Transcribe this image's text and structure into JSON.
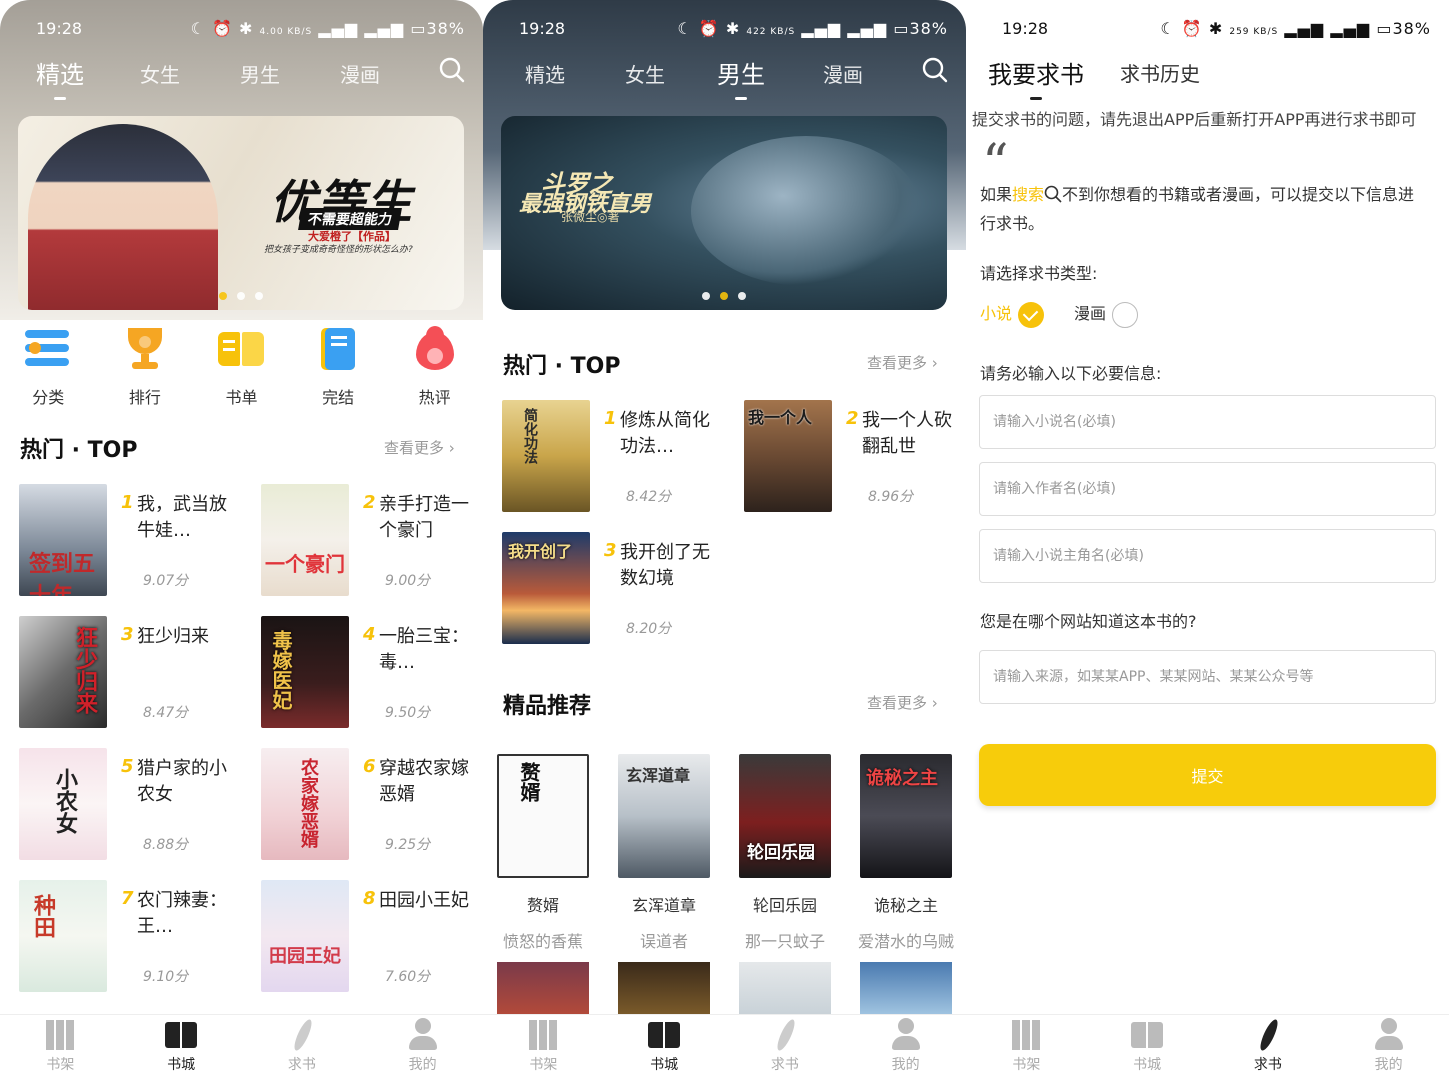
{
  "status": {
    "time": "19:28",
    "p1_speed": "4.00 KB/S",
    "p2_speed": "422 KB/S",
    "p3_speed": "259 KB/S",
    "battery": "38%"
  },
  "top_tabs": [
    "精选",
    "女生",
    "男生",
    "漫画"
  ],
  "panel1": {
    "active_tab": "精选",
    "banner": {
      "title": "优等生",
      "subtitle": "不需要超能力",
      "author": "大爱橙了【作品】",
      "desc": "把女孩子变成奇奇怪怪的形状怎么办?"
    },
    "categories": [
      {
        "label": "分类",
        "icon": "category-icon",
        "color": "#3aa0f2"
      },
      {
        "label": "排行",
        "icon": "trophy-icon",
        "color": "#f5a623"
      },
      {
        "label": "书单",
        "icon": "booklist-icon",
        "color": "#f7c20a"
      },
      {
        "label": "完结",
        "icon": "finished-icon",
        "color": "#3aa0f2"
      },
      {
        "label": "热评",
        "icon": "flame-icon",
        "color": "#f44f56"
      }
    ],
    "section_title": "热门 · TOP",
    "more": "查看更多 ›",
    "books": [
      {
        "rank": "1",
        "title": "我，武当放牛娃…",
        "score": "9.07分"
      },
      {
        "rank": "2",
        "title": "亲手打造一个豪门",
        "score": "9.00分"
      },
      {
        "rank": "3",
        "title": "狂少归来",
        "score": "8.47分"
      },
      {
        "rank": "4",
        "title": "一胎三宝：毒…",
        "score": "9.50分"
      },
      {
        "rank": "5",
        "title": "猎户家的小农女",
        "score": "8.88分"
      },
      {
        "rank": "6",
        "title": "穿越农家嫁恶婿",
        "score": "9.25分"
      },
      {
        "rank": "7",
        "title": "农门辣妻：王…",
        "score": "9.10分"
      },
      {
        "rank": "8",
        "title": "田园小王妃",
        "score": "7.60分"
      }
    ],
    "covers": [
      "签到五十年",
      "一个豪门",
      "狂少归来",
      "毒嫁医妃",
      "小农女",
      "农家嫁恶婿",
      "种田",
      "田园王妃"
    ]
  },
  "panel2": {
    "active_tab": "男生",
    "banner": {
      "title1": "斗罗之",
      "title2": "最强钢铁直男",
      "author": "张微尘◎著"
    },
    "section_title": "热门 · TOP",
    "more": "查看更多 ›",
    "books": [
      {
        "rank": "1",
        "title": "修炼从简化功法…",
        "score": "8.42分",
        "cover": "简化功法"
      },
      {
        "rank": "2",
        "title": "我一个人砍翻乱世",
        "score": "8.96分",
        "cover": "我一个人"
      },
      {
        "rank": "3",
        "title": "我开创了无数幻境",
        "score": "8.20分",
        "cover": "我开创了"
      }
    ],
    "rec_title": "精品推荐",
    "rec_more": "查看更多 ›",
    "recs": [
      {
        "name": "赘婿",
        "author": "愤怒的香蕉",
        "cover": "赘婿"
      },
      {
        "name": "玄浑道章",
        "author": "误道者",
        "cover": "玄浑道章"
      },
      {
        "name": "轮回乐园",
        "author": "那一只蚊子",
        "cover": "轮回乐园"
      },
      {
        "name": "诡秘之主",
        "author": "爱潜水的乌贼",
        "cover": "诡秘之主"
      }
    ]
  },
  "panel3": {
    "tabs": [
      "我要求书",
      "求书历史"
    ],
    "notice": "提交求书的问题，请先退出APP后重新打开APP再进行求书即可",
    "intro_a": "如果",
    "intro_hl": "搜索",
    "intro_b": "不到你想看的书籍或者漫画，可以提交以下信息进行求书。",
    "type_label": "请选择求书类型:",
    "type_novel": "小说",
    "type_comic": "漫画",
    "info_label": "请务必输入以下必要信息:",
    "ph_name": "请输入小说名(必填)",
    "ph_author": "请输入作者名(必填)",
    "ph_hero": "请输入小说主角名(必填)",
    "source_label": "您是在哪个网站知道这本书的?",
    "ph_source": "请输入来源，如某某APP、某某网站、某某公众号等",
    "submit": "提交"
  },
  "bottom_nav": [
    "书架",
    "书城",
    "求书",
    "我的"
  ]
}
